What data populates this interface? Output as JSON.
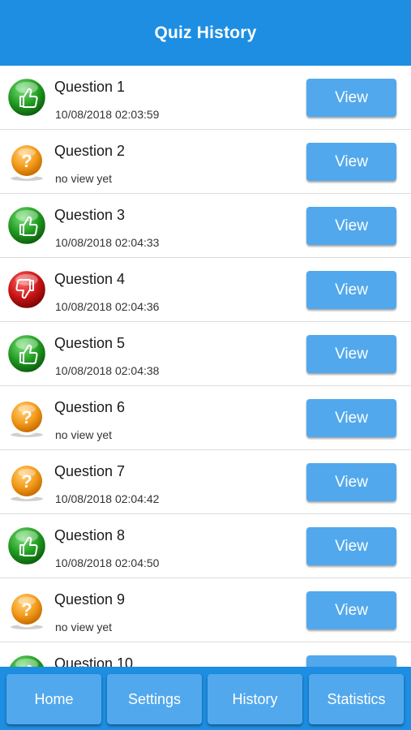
{
  "header": {
    "title": "Quiz History"
  },
  "view_label": "View",
  "rows": [
    {
      "title": "Question 1",
      "subtitle": "10/08/2018 02:03:59",
      "status": "thumbs-up-icon"
    },
    {
      "title": "Question 2",
      "subtitle": "no view yet",
      "status": "question-mark-icon"
    },
    {
      "title": "Question 3",
      "subtitle": "10/08/2018 02:04:33",
      "status": "thumbs-up-icon"
    },
    {
      "title": "Question 4",
      "subtitle": "10/08/2018 02:04:36",
      "status": "thumbs-down-icon"
    },
    {
      "title": "Question 5",
      "subtitle": "10/08/2018 02:04:38",
      "status": "thumbs-up-icon"
    },
    {
      "title": "Question 6",
      "subtitle": "no view yet",
      "status": "question-mark-icon"
    },
    {
      "title": "Question 7",
      "subtitle": "10/08/2018 02:04:42",
      "status": "question-mark-icon"
    },
    {
      "title": "Question 8",
      "subtitle": "10/08/2018 02:04:50",
      "status": "thumbs-up-icon"
    },
    {
      "title": "Question 9",
      "subtitle": "no view yet",
      "status": "question-mark-icon"
    },
    {
      "title": "Question 10",
      "subtitle": "",
      "status": "thumbs-up-icon"
    }
  ],
  "tabs": [
    {
      "label": "Home"
    },
    {
      "label": "Settings"
    },
    {
      "label": "History"
    },
    {
      "label": "Statistics"
    }
  ],
  "colors": {
    "header": "#1d8ee2",
    "button": "#52a8ec",
    "correct": "#1f9a1f",
    "incorrect": "#c81414",
    "unanswered": "#f39a1a"
  }
}
